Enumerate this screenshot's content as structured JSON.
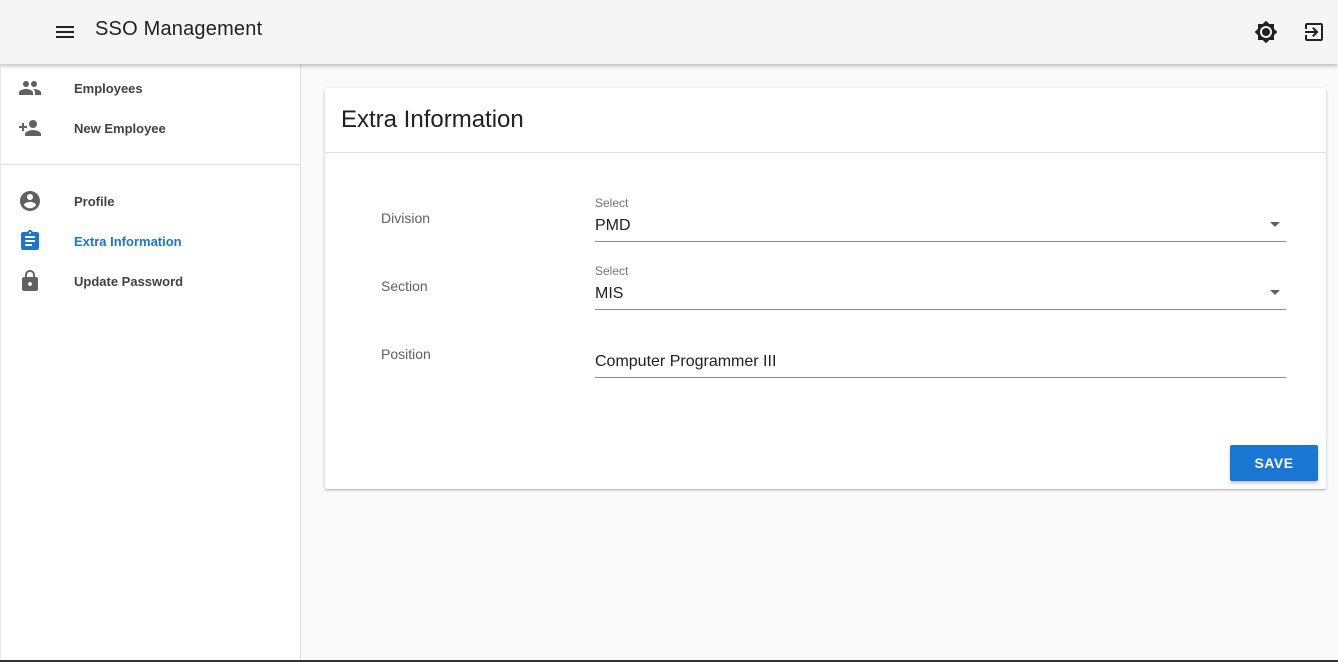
{
  "header": {
    "title": "SSO Management",
    "icons": {
      "menu": "menu-icon",
      "theme": "brightness-icon",
      "logout": "logout-icon"
    }
  },
  "sidebar": {
    "group1": [
      {
        "label": "Employees",
        "icon": "people-icon"
      },
      {
        "label": "New Employee",
        "icon": "person-add-icon"
      }
    ],
    "group2": [
      {
        "label": "Profile",
        "icon": "account-circle-icon"
      },
      {
        "label": "Extra Information",
        "icon": "assignment-icon",
        "active": true
      },
      {
        "label": "Update Password",
        "icon": "lock-icon"
      }
    ]
  },
  "main": {
    "card_title": "Extra Information",
    "fields": {
      "division": {
        "label": "Division",
        "caption": "Select",
        "value": "PMD"
      },
      "section": {
        "label": "Section",
        "caption": "Select",
        "value": "MIS"
      },
      "position": {
        "label": "Position",
        "value": "Computer Programmer III"
      }
    },
    "save_label": "SAVE"
  },
  "colors": {
    "accent": "#1976d2",
    "appbar": "#f5f5f5",
    "background": "#fafafa"
  }
}
